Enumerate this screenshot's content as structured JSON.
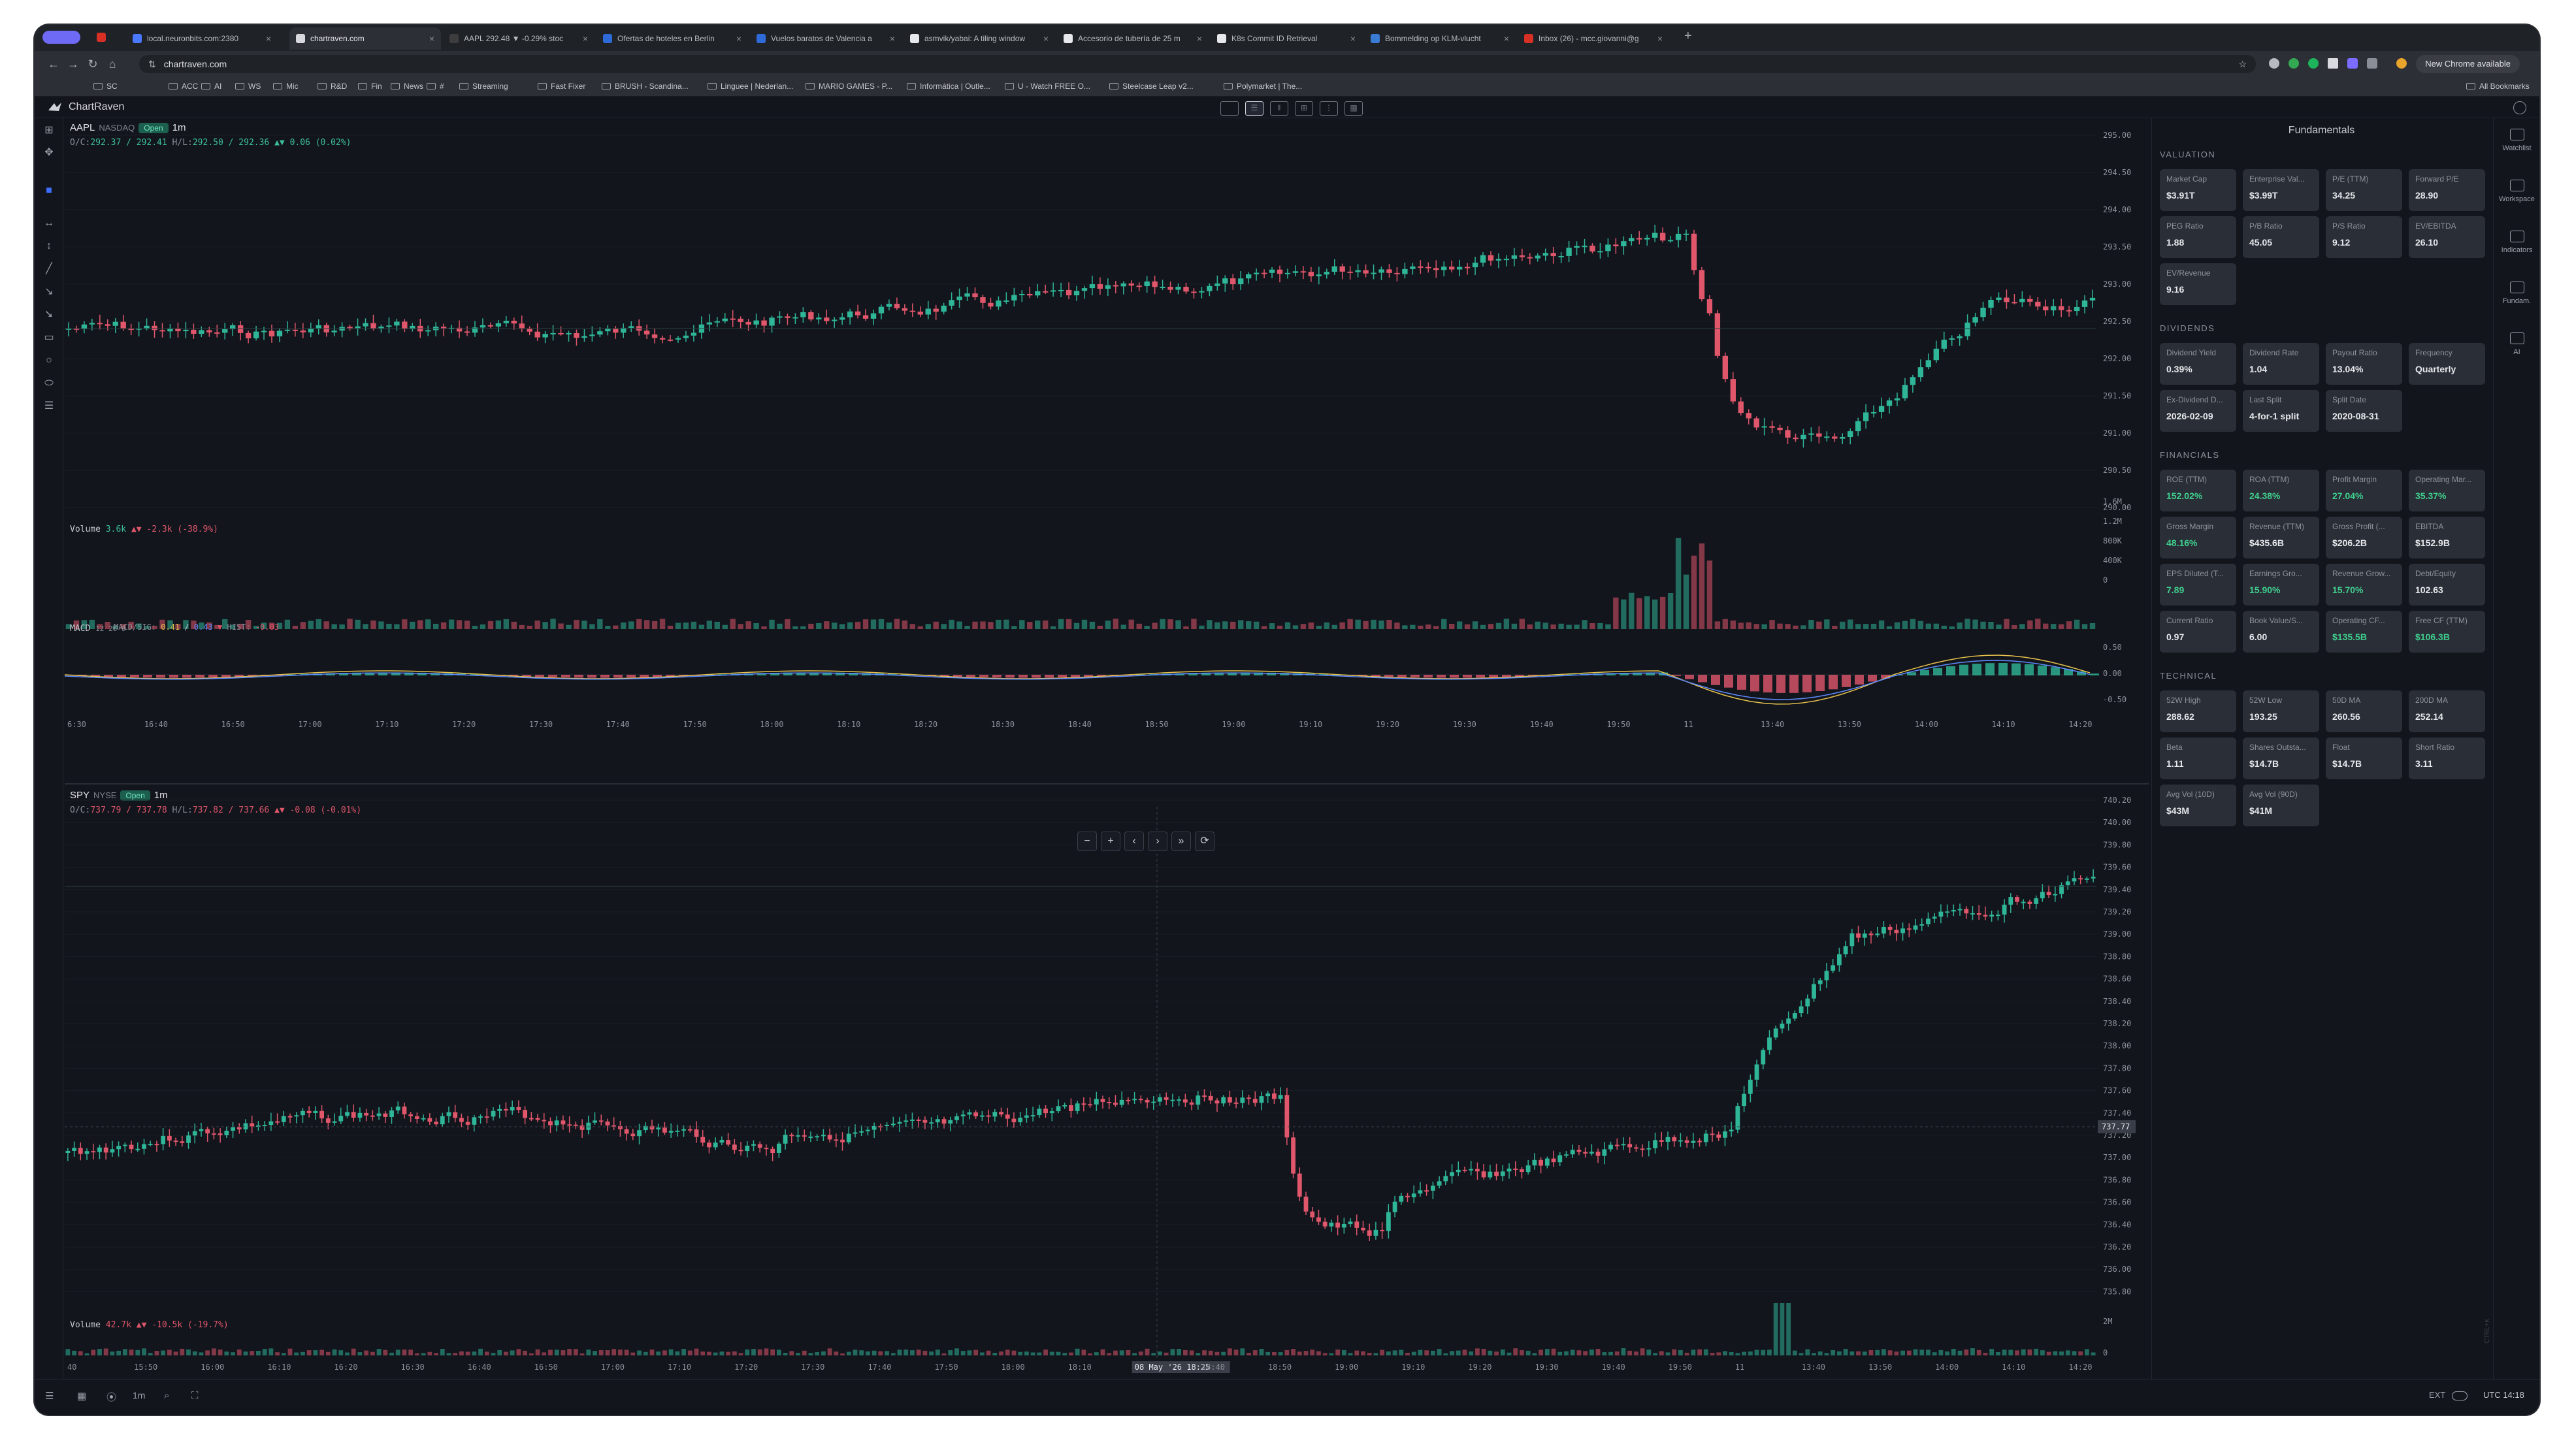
{
  "tabs": [
    {
      "label": "local.neuronbits.com:2380",
      "fav": "#4a78ff"
    },
    {
      "label": "chartraven.com",
      "fav": "#d6d8dd",
      "active": true
    },
    {
      "label": "AAPL 292.48 ▼ -0.29% stoc",
      "fav": "#3d3d3d"
    },
    {
      "label": "Ofertas de hoteles en Berlin",
      "fav": "#2f6bd8"
    },
    {
      "label": "Vuelos baratos de Valencia a",
      "fav": "#2f6bd8"
    },
    {
      "label": "asmvik/yabai: A tiling window",
      "fav": "#e6e8ec"
    },
    {
      "label": "Accesorio de tubería de 25 m",
      "fav": "#e6e8ec"
    },
    {
      "label": "K8s Commit ID Retrieval",
      "fav": "#e6e8ec"
    },
    {
      "label": "Bommelding op KLM-vlucht",
      "fav": "#3a7bd5"
    },
    {
      "label": "Inbox (26) - mcc.giovanni@g",
      "fav": "#d93025"
    }
  ],
  "address": {
    "url": "chartraven.com",
    "update_label": "New Chrome available"
  },
  "bookmarks": [
    "SC",
    "ACC",
    "AI",
    "WS",
    "Mic",
    "R&D",
    "Fin",
    "News",
    "#",
    "Streaming",
    "Fast Fixer",
    "BRUSH - Scandina...",
    "Linguee | Nederlan...",
    "MARIO GAMES - P...",
    "Informática | Outle...",
    "U - Watch FREE O...",
    "Steelcase Leap v2...",
    "Polymarket | The..."
  ],
  "all_bookmarks": "All Bookmarks",
  "app": {
    "brand": "ChartRaven"
  },
  "aapl": {
    "symbol": "AAPL",
    "exchange": "NASDAQ",
    "status": "Open",
    "interval": "1m",
    "oc_label": "O/C:",
    "oc": "292.37 / 292.41",
    "hl_label": "H/L:",
    "hl": "292.50 / 292.36",
    "chg": "▲▼ 0.06 (0.02%)",
    "volume_label": "Volume",
    "volume": "3.6k",
    "volume_chg": "▲▼ -2.3k (-38.9%)",
    "macd_label": "MACD",
    "macd_params": "12 26 9",
    "macd_sig_label": "MACD/SIG:",
    "macd_val": "0.41",
    "macd_sig": "0.43",
    "macd_hist_label": "HIST:",
    "macd_hist": "-0.03",
    "price_ticks": [
      "295.00",
      "294.50",
      "294.00",
      "293.50",
      "293.00",
      "292.50",
      "292.00",
      "291.50",
      "291.00",
      "290.50",
      "290.00"
    ],
    "vol_ticks": [
      "1.6M",
      "1.2M",
      "800K",
      "400K",
      "0"
    ],
    "macd_ticks": [
      "0.50",
      "0.00",
      "-0.50"
    ],
    "time_ticks": [
      "6:30",
      "16:40",
      "16:50",
      "17:00",
      "17:10",
      "17:20",
      "17:30",
      "17:40",
      "17:50",
      "18:00",
      "18:10",
      "18:20",
      "18:30",
      "18:40",
      "18:50",
      "19:00",
      "19:10",
      "19:20",
      "19:30",
      "19:40",
      "19:50",
      "11",
      "13:40",
      "13:50",
      "14:00",
      "14:10",
      "14:20"
    ]
  },
  "spy": {
    "symbol": "SPY",
    "exchange": "NYSE",
    "status": "Open",
    "interval": "1m",
    "oc_label": "O/C:",
    "oc": "737.79 / 737.78",
    "hl_label": "H/L:",
    "hl": "737.82 / 737.66",
    "chg": "▲▼ -0.08 (-0.01%)",
    "volume_label": "Volume",
    "volume": "42.7k",
    "volume_chg": "▲▼ -10.5k (-19.7%)",
    "price_ticks": [
      "740.20",
      "740.00",
      "739.80",
      "739.60",
      "739.40",
      "739.20",
      "739.00",
      "738.80",
      "738.60",
      "738.40",
      "738.20",
      "738.00",
      "737.80",
      "737.60",
      "737.40",
      "737.20",
      "737.00",
      "736.80",
      "736.60",
      "736.40",
      "736.20",
      "736.00",
      "735.80"
    ],
    "last_price": "737.77",
    "vol_ticks": [
      "2M",
      "0"
    ],
    "time_ticks": [
      "40",
      "15:50",
      "16:00",
      "16:10",
      "16:20",
      "16:30",
      "16:40",
      "16:50",
      "17:00",
      "17:10",
      "17:20",
      "17:30",
      "17:40",
      "17:50",
      "18:00",
      "18:10",
      "08 May '26 18:25",
      "18:40",
      "18:50",
      "19:00",
      "19:10",
      "19:20",
      "19:30",
      "19:40",
      "19:50",
      "11",
      "13:40",
      "13:50",
      "14:00",
      "14:10",
      "14:20"
    ]
  },
  "chart_nav": [
    "−",
    "+",
    "‹",
    "›",
    "»",
    "⟳"
  ],
  "bottom": {
    "interval": "1m",
    "ext": "EXT",
    "clock": "UTC 14:18",
    "watermark": "CTRL+K"
  },
  "fundamentals": {
    "title": "Fundamentals",
    "sections": [
      {
        "name": "VALUATION",
        "cards": [
          {
            "label": "Market Cap",
            "value": "$3.91T"
          },
          {
            "label": "Enterprise Val...",
            "value": "$3.99T"
          },
          {
            "label": "P/E (TTM)",
            "value": "34.25"
          },
          {
            "label": "Forward P/E",
            "value": "28.90"
          },
          {
            "label": "PEG Ratio",
            "value": "1.88"
          },
          {
            "label": "P/B Ratio",
            "value": "45.05"
          },
          {
            "label": "P/S Ratio",
            "value": "9.12"
          },
          {
            "label": "EV/EBITDA",
            "value": "26.10"
          },
          {
            "label": "EV/Revenue",
            "value": "9.16"
          }
        ]
      },
      {
        "name": "DIVIDENDS",
        "cards": [
          {
            "label": "Dividend Yield",
            "value": "0.39%"
          },
          {
            "label": "Dividend Rate",
            "value": "1.04"
          },
          {
            "label": "Payout Ratio",
            "value": "13.04%"
          },
          {
            "label": "Frequency",
            "value": "Quarterly"
          },
          {
            "label": "Ex-Dividend D...",
            "value": "2026-02-09"
          },
          {
            "label": "Last Split",
            "value": "4-for-1 split"
          },
          {
            "label": "Split Date",
            "value": "2020-08-31"
          }
        ]
      },
      {
        "name": "FINANCIALS",
        "cards": [
          {
            "label": "ROE (TTM)",
            "value": "152.02%",
            "green": true
          },
          {
            "label": "ROA (TTM)",
            "value": "24.38%",
            "green": true
          },
          {
            "label": "Profit Margin",
            "value": "27.04%",
            "green": true
          },
          {
            "label": "Operating Mar...",
            "value": "35.37%",
            "green": true
          },
          {
            "label": "Gross Margin",
            "value": "48.16%",
            "green": true
          },
          {
            "label": "Revenue (TTM)",
            "value": "$435.6B"
          },
          {
            "label": "Gross Profit (...",
            "value": "$206.2B"
          },
          {
            "label": "EBITDA",
            "value": "$152.9B"
          },
          {
            "label": "EPS Diluted (T...",
            "value": "7.89",
            "green": true
          },
          {
            "label": "Earnings Gro...",
            "value": "15.90%",
            "green": true
          },
          {
            "label": "Revenue Grow...",
            "value": "15.70%",
            "green": true
          },
          {
            "label": "Debt/Equity",
            "value": "102.63"
          },
          {
            "label": "Current Ratio",
            "value": "0.97"
          },
          {
            "label": "Book Value/S...",
            "value": "6.00"
          },
          {
            "label": "Operating CF...",
            "value": "$135.5B",
            "green": true
          },
          {
            "label": "Free CF (TTM)",
            "value": "$106.3B",
            "green": true
          }
        ]
      },
      {
        "name": "TECHNICAL",
        "cards": [
          {
            "label": "52W High",
            "value": "288.62"
          },
          {
            "label": "52W Low",
            "value": "193.25"
          },
          {
            "label": "50D MA",
            "value": "260.56"
          },
          {
            "label": "200D MA",
            "value": "252.14"
          },
          {
            "label": "Beta",
            "value": "1.11"
          },
          {
            "label": "Shares Outsta...",
            "value": "$14.7B"
          },
          {
            "label": "Float",
            "value": "$14.7B"
          },
          {
            "label": "Short Ratio",
            "value": "3.11"
          },
          {
            "label": "Avg Vol (10D)",
            "value": "$43M"
          },
          {
            "label": "Avg Vol (90D)",
            "value": "$41M"
          }
        ]
      }
    ]
  },
  "right_sidebar": [
    "Watchlist",
    "Workspace",
    "Indicators",
    "Fundam.",
    "AI"
  ],
  "colors": {
    "up": "#2fb597",
    "down": "#e0566b",
    "bg": "#12151c",
    "accent": "#3f6fff"
  }
}
